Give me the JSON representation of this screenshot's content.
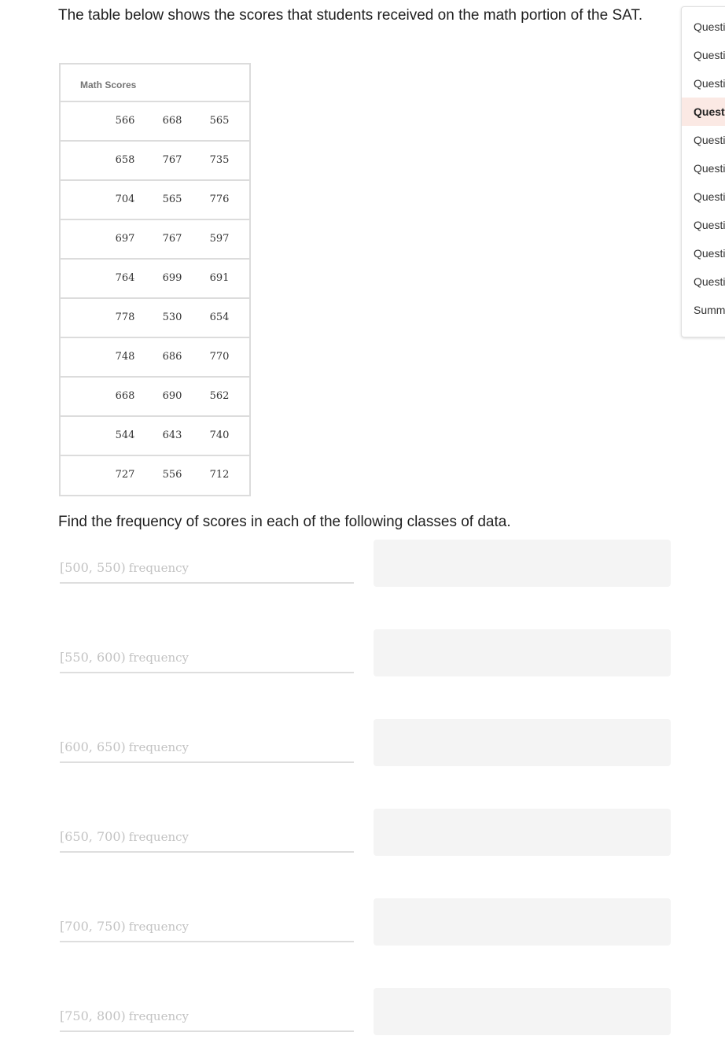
{
  "question": {
    "prompt": "The table below shows the scores that students received on the math portion of the SAT.",
    "table_header": "Math Scores",
    "rows": [
      [
        "566",
        "668",
        "565"
      ],
      [
        "658",
        "767",
        "735"
      ],
      [
        "704",
        "565",
        "776"
      ],
      [
        "697",
        "767",
        "597"
      ],
      [
        "764",
        "699",
        "691"
      ],
      [
        "778",
        "530",
        "654"
      ],
      [
        "748",
        "686",
        "770"
      ],
      [
        "668",
        "690",
        "562"
      ],
      [
        "544",
        "643",
        "740"
      ],
      [
        "727",
        "556",
        "712"
      ]
    ],
    "subprompt": "Find the frequency of scores in each of the following classes of data.",
    "classes": [
      {
        "range": "[500, 550)",
        "label": "frequency",
        "value": ""
      },
      {
        "range": "[550, 600)",
        "label": "frequency",
        "value": ""
      },
      {
        "range": "[600, 650)",
        "label": "frequency",
        "value": ""
      },
      {
        "range": "[650, 700)",
        "label": "frequency",
        "value": ""
      },
      {
        "range": "[700, 750)",
        "label": "frequency",
        "value": ""
      },
      {
        "range": "[750, 800)",
        "label": "frequency",
        "value": ""
      }
    ]
  },
  "sidebar": {
    "items": [
      {
        "label": "Questi",
        "active": false
      },
      {
        "label": "Questi",
        "active": false
      },
      {
        "label": "Questi",
        "active": false
      },
      {
        "label": "Questi",
        "active": true
      },
      {
        "label": "Questi",
        "active": false
      },
      {
        "label": "Questi",
        "active": false
      },
      {
        "label": "Questi",
        "active": false
      },
      {
        "label": "Questi",
        "active": false
      },
      {
        "label": "Questi",
        "active": false
      },
      {
        "label": "Questi",
        "active": false
      },
      {
        "label": "Summ",
        "active": false
      }
    ],
    "active_color": "#fbe9e4"
  }
}
